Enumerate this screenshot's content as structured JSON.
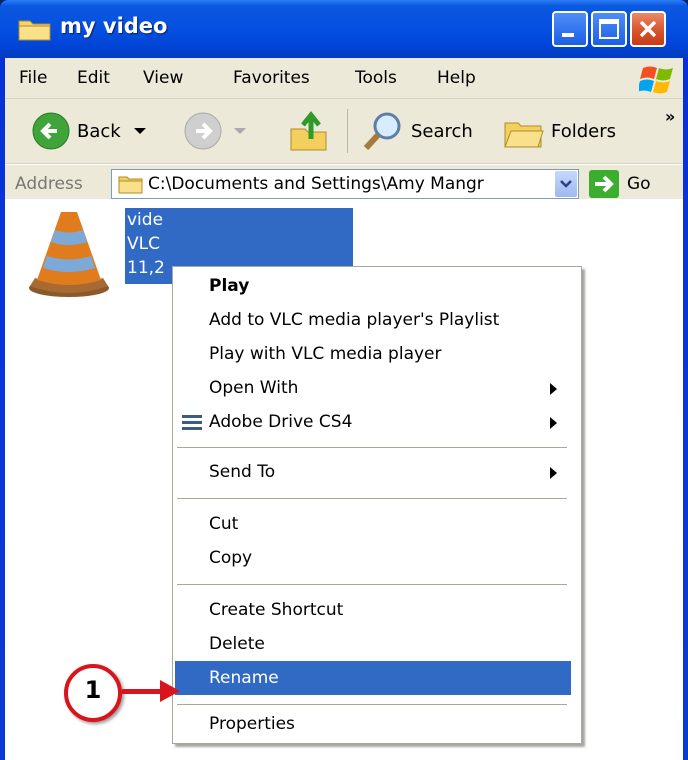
{
  "window": {
    "title": "my video"
  },
  "menubar": {
    "items": [
      "File",
      "Edit",
      "View",
      "Favorites",
      "Tools",
      "Help"
    ]
  },
  "toolbar": {
    "back_label": "Back",
    "search_label": "Search",
    "folders_label": "Folders",
    "overflow": "»"
  },
  "address": {
    "label": "Address",
    "path": "C:\\Documents and Settings\\Amy Mangr",
    "go_label": "Go"
  },
  "file": {
    "line1": "vide",
    "line2": "VLC",
    "line3": "11,2"
  },
  "context_menu": {
    "items": [
      {
        "label": "Play",
        "bold": true
      },
      {
        "label": "Add to VLC media player's Playlist"
      },
      {
        "label": "Play with VLC media player"
      },
      {
        "label": "Open With",
        "submenu": true
      },
      {
        "label": "Adobe Drive CS4",
        "submenu": true,
        "icon": "adobe-drive-icon"
      },
      {
        "label": "Send To",
        "submenu": true
      },
      {
        "label": "Cut"
      },
      {
        "label": "Copy"
      },
      {
        "label": "Create Shortcut"
      },
      {
        "label": "Delete"
      },
      {
        "label": "Rename",
        "highlighted": true
      },
      {
        "label": "Properties"
      }
    ]
  },
  "callout": {
    "number": "1"
  },
  "colors": {
    "selection": "#316ac5",
    "callout_red": "#d8141d",
    "title_blue": "#0550e0"
  }
}
